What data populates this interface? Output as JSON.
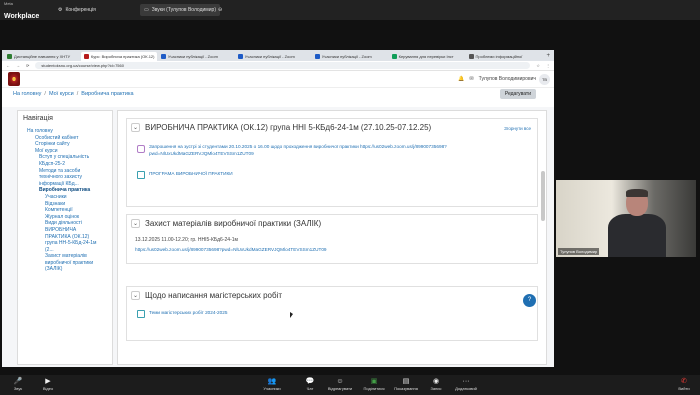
{
  "workplace": {
    "brand_small": "Meta",
    "brand": "Workplace",
    "tabs": [
      {
        "label": "Конференція",
        "icon": "gear-icon"
      },
      {
        "label": "Звуки (Тулупов Володимир)",
        "icon": "video-icon",
        "active": true
      }
    ]
  },
  "browser": {
    "tabs": [
      {
        "label": "Дистанційне навчання у ХНТУ",
        "color": "#2e7d32"
      },
      {
        "label": "Курс: Виробнича практика (ОК.12)",
        "color": "#b71c1c",
        "active": true
      },
      {
        "label": "Учасники публікації - Zoom",
        "color": "#1e5bc6"
      },
      {
        "label": "Учасники публікації - Zoom",
        "color": "#1e5bc6"
      },
      {
        "label": "Учасники публікації - Zoom",
        "color": "#1e5bc6"
      },
      {
        "label": "Керування для перевірки Інст",
        "color": "#0f9d58"
      },
      {
        "label": "Проблеми інформаційної",
        "color": "#555555"
      }
    ],
    "new_tab": "+",
    "url": "studentoksnu.org.ua/course/view.php?id=7560"
  },
  "moodle": {
    "user_name": "Тулупов Володимирович",
    "avatar": "TB",
    "breadcrumb": [
      "На головну",
      "Мої курси",
      "Виробнича практика"
    ],
    "edit_button": "Редагувати",
    "nav_title": "Навігація",
    "nav": [
      {
        "label": "На головну",
        "level": "l1"
      },
      {
        "label": "Особистий кабінет",
        "level": "l2"
      },
      {
        "label": "Сторінки сайту",
        "level": "l2"
      },
      {
        "label": "Мої курси",
        "level": "l2"
      },
      {
        "label": "Вступ у спеціальність",
        "level": "l3"
      },
      {
        "label": "КБдсп-25-2",
        "level": "l3"
      },
      {
        "label": "Методи та засоби",
        "level": "l3"
      },
      {
        "label": "технічного захисту",
        "level": "l3"
      },
      {
        "label": "інформації КБд...",
        "level": "l3"
      },
      {
        "label": "Виробнича практика",
        "level": "l3",
        "current": true
      },
      {
        "label": "Учасники",
        "level": "l4"
      },
      {
        "label": "Відзнаки",
        "level": "l4"
      },
      {
        "label": "Компетенції",
        "level": "l4"
      },
      {
        "label": "Журнал оцінок",
        "level": "l4"
      },
      {
        "label": "Види діяльності",
        "level": "l4"
      },
      {
        "label": "ВИРОБНИЧА",
        "level": "l4"
      },
      {
        "label": "ПРАКТИКА (ОК.12)",
        "level": "l4"
      },
      {
        "label": "група НН-5-КБд-24-1м",
        "level": "l4"
      },
      {
        "label": "(2...",
        "level": "l4"
      },
      {
        "label": "Захист матеріалів",
        "level": "l4"
      },
      {
        "label": "виробничої практики",
        "level": "l4"
      },
      {
        "label": "(ЗАЛІК)",
        "level": "l4"
      }
    ],
    "sections": [
      {
        "title": "ВИРОБНИЧА ПРАКТИКА (ОК.12) група ННІ 5-КБд6-24-1м (27.10.25-07.12.25)",
        "collapse": "Згорнути все",
        "announcement": "Запрошення на зустрі зі студентами 20.10.2025 о 16.00 щодо проходження виробничої практики https://us02web.zoom.us/j/89900735698?pwd=NlUxUkdMaGZERVJQMlo4TEVSSm1ZUT09",
        "file": "ПРОГРАМА ВИРОБНИЧОЇ ПРАКТИКИ"
      },
      {
        "title": "Захист матеріалів виробничої практики (ЗАЛІК)",
        "text": "13.12.2025 11.00-12.20; гр. ННІ5-КБд6-24-1м",
        "link": "https://us02web.zoom.us/j/89900735698?pwd=NlUxUkdMaGZERVJQMlo4TEVSSm1ZUT09"
      },
      {
        "title": "Щодо написання магістерських робіт",
        "file": "Теми магістерських робіт 2024-2025"
      }
    ]
  },
  "video": {
    "name": "Тулупов Володимир"
  },
  "toolbar": {
    "left": [
      {
        "label": "Звук",
        "icon": "mic-icon"
      },
      {
        "label": "Відео",
        "icon": "camera-icon"
      }
    ],
    "center": [
      {
        "label": "Учасники",
        "icon": "people-icon",
        "count": "4"
      },
      {
        "label": "Чат",
        "icon": "chat-icon"
      },
      {
        "label": "Відреагувати",
        "icon": "reaction-icon"
      },
      {
        "label": "Поділитися",
        "icon": "share-icon"
      },
      {
        "label": "Показування",
        "icon": "present-icon"
      },
      {
        "label": "Запис",
        "icon": "record-icon"
      },
      {
        "label": "Додатковий",
        "icon": "more-icon"
      }
    ],
    "right": [
      {
        "label": "Вийти",
        "icon": "leave-icon"
      }
    ]
  }
}
